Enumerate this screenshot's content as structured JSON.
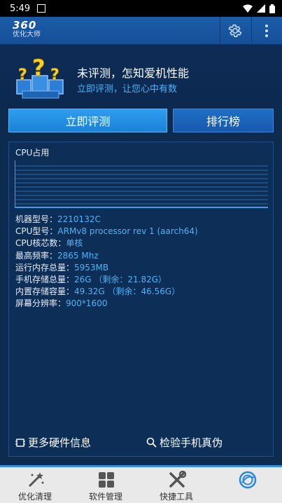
{
  "status_bar": {
    "time": "5:49"
  },
  "app": {
    "logo_number": "360",
    "logo_subtitle": "优化大师",
    "settings_icon": "gear-icon",
    "menu_icon": "more-vertical-icon"
  },
  "banner": {
    "title": "未评测，怎知爱机性能",
    "subtitle": "立即评测，让您心中有数"
  },
  "buttons": {
    "evaluate": "立即评测",
    "ranking": "排行榜"
  },
  "panel": {
    "cpu_usage_label": "CPU占用",
    "specs": [
      {
        "label": "机器型号：",
        "value": "2210132C"
      },
      {
        "label": "CPU型号：",
        "value": "ARMv8 processor rev 1 (aarch64)"
      },
      {
        "label": "CPU核芯数：",
        "value": "单核"
      },
      {
        "label": "最高频率：",
        "value": "2865 Mhz"
      },
      {
        "label": "运行内存总量：",
        "value": "5953MB"
      },
      {
        "label": "手机存储总量：",
        "value": "26G （剩余：21.82G）"
      },
      {
        "label": "内置存储容量：",
        "value": "49.32G （剩余：46.56G）"
      },
      {
        "label": "屏幕分辨率：",
        "value": "900*1600"
      }
    ],
    "more_hardware": "更多硬件信息",
    "verify_phone": "检验手机真伪"
  },
  "bottom_nav": [
    {
      "label": "优化清理",
      "icon": "magic-wand-icon"
    },
    {
      "label": "软件管理",
      "icon": "app-grid-icon"
    },
    {
      "label": "快捷工具",
      "icon": "tools-icon"
    },
    {
      "label": "",
      "icon": "speed-ring-icon"
    }
  ],
  "colors": {
    "background": "#0d2a4f",
    "header": "#1a58a3",
    "accent_button": "#2a95ea",
    "value_text": "#4fb3f7",
    "graph_line": "#3aa0e8",
    "nav_bar": "#e9e9e9"
  }
}
